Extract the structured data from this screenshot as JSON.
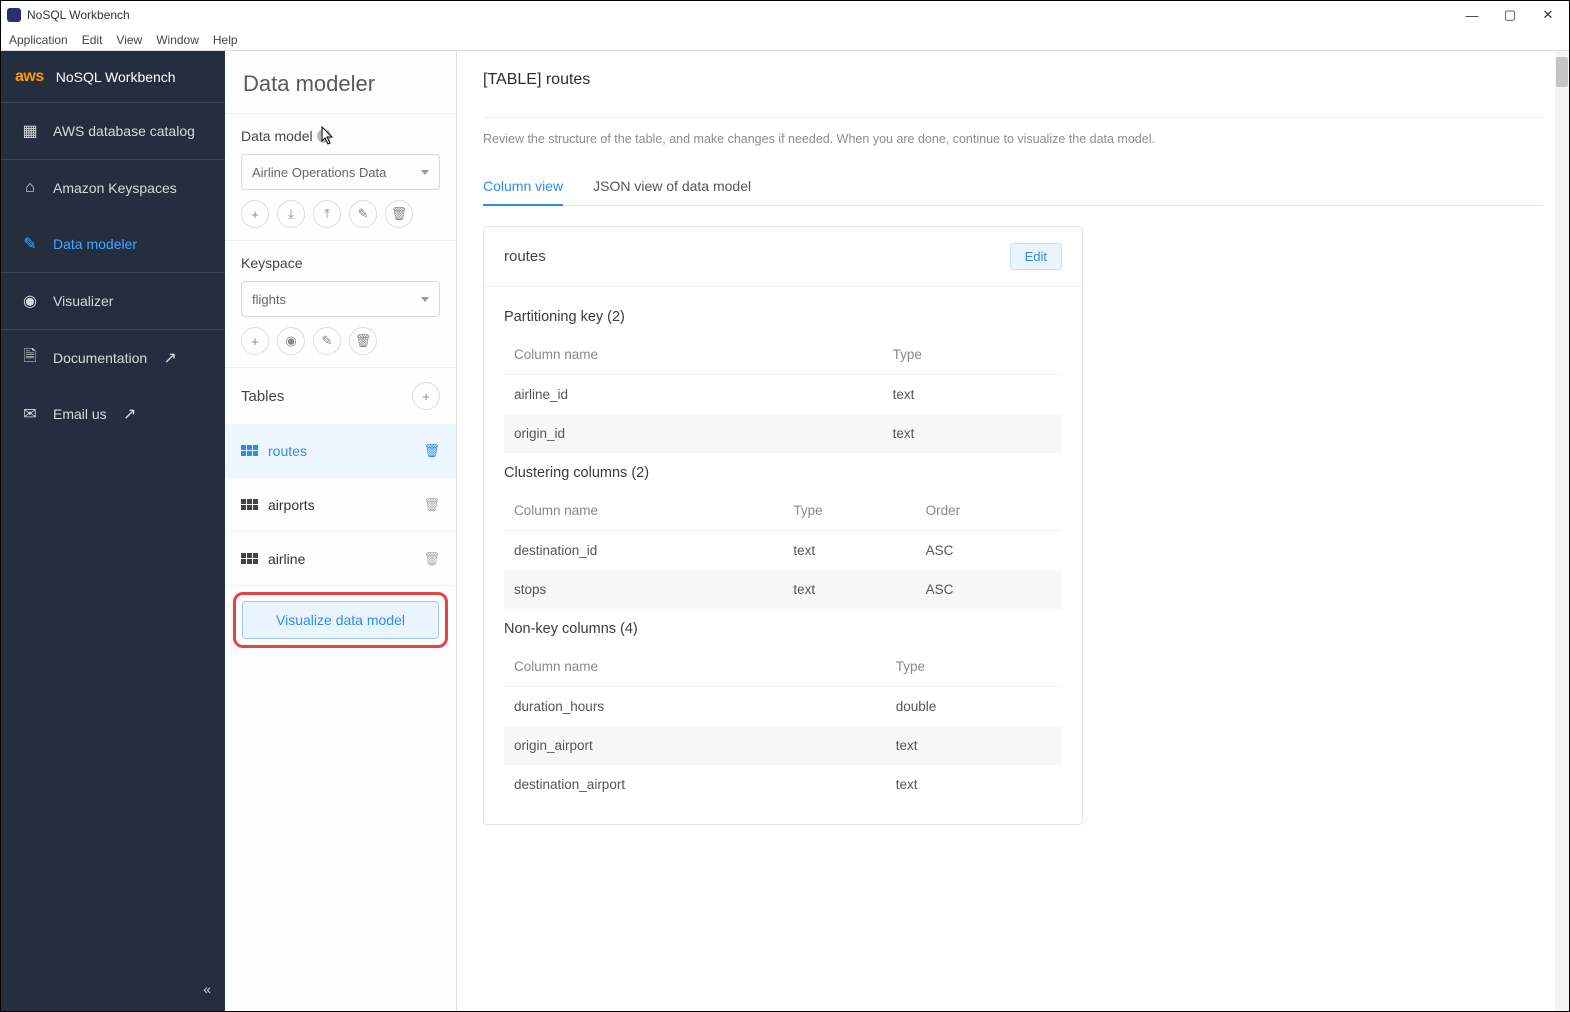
{
  "window": {
    "title": "NoSQL Workbench"
  },
  "menubar": [
    "Application",
    "Edit",
    "View",
    "Window",
    "Help"
  ],
  "brand": {
    "logo": "aws",
    "product": "NoSQL Workbench"
  },
  "nav": {
    "items": [
      {
        "label": "AWS database catalog"
      },
      {
        "label": "Amazon Keyspaces"
      },
      {
        "label": "Data modeler"
      },
      {
        "label": "Visualizer"
      },
      {
        "label": "Documentation"
      },
      {
        "label": "Email us"
      }
    ]
  },
  "mid": {
    "title": "Data modeler",
    "data_model_label": "Data model",
    "data_model_value": "Airline Operations Data",
    "keyspace_label": "Keyspace",
    "keyspace_value": "flights",
    "tables_label": "Tables",
    "tables": [
      {
        "name": "routes"
      },
      {
        "name": "airports"
      },
      {
        "name": "airline"
      }
    ],
    "visualize_label": "Visualize data model"
  },
  "main": {
    "heading": "[TABLE] routes",
    "description": "Review the structure of the table, and make changes if needed. When you are done, continue to visualize the data model.",
    "tabs": {
      "column_view": "Column view",
      "json_view": "JSON view of data model"
    },
    "table_name": "routes",
    "edit_label": "Edit",
    "partitioning_title": "Partitioning key (2)",
    "clustering_title": "Clustering columns (2)",
    "nonkey_title": "Non-key columns (4)",
    "headers": {
      "column": "Column name",
      "type": "Type",
      "order": "Order"
    },
    "partition_keys": [
      {
        "name": "airline_id",
        "type": "text"
      },
      {
        "name": "origin_id",
        "type": "text"
      }
    ],
    "clustering_cols": [
      {
        "name": "destination_id",
        "type": "text",
        "order": "ASC"
      },
      {
        "name": "stops",
        "type": "text",
        "order": "ASC"
      }
    ],
    "nonkey_cols": [
      {
        "name": "duration_hours",
        "type": "double"
      },
      {
        "name": "origin_airport",
        "type": "text"
      },
      {
        "name": "destination_airport",
        "type": "text"
      }
    ]
  }
}
